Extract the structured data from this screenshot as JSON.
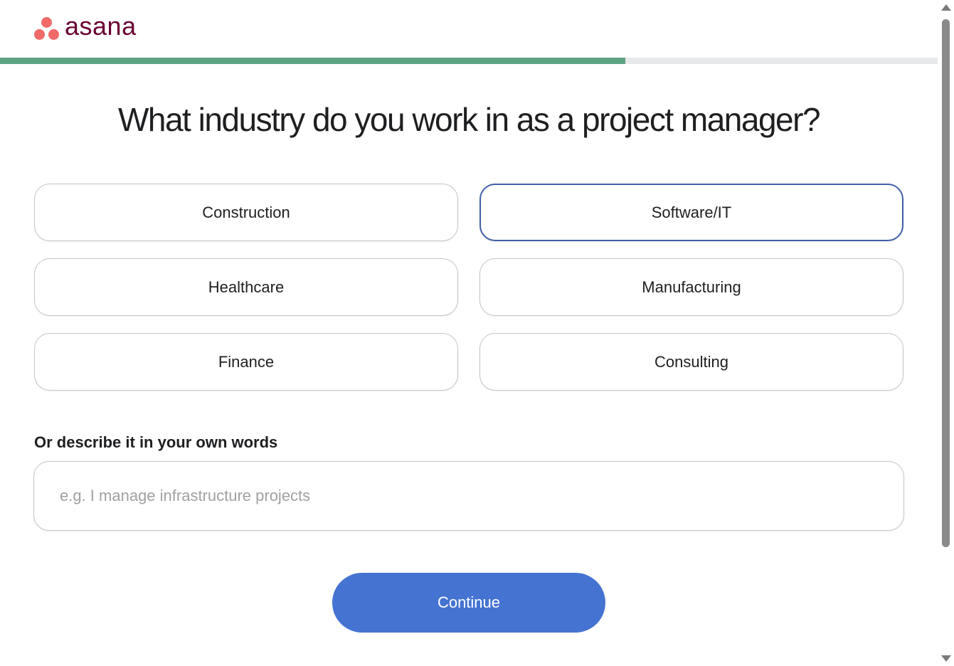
{
  "brand": {
    "name": "asana",
    "logo_color": "#690031",
    "dot_color": "#f06a6a"
  },
  "progress": {
    "fraction": 0.667,
    "fill_color": "#5da283"
  },
  "question": {
    "title": "What industry do you work in as a project manager?"
  },
  "options": [
    {
      "label": "Construction",
      "selected": false
    },
    {
      "label": "Software/IT",
      "selected": true
    },
    {
      "label": "Healthcare",
      "selected": false
    },
    {
      "label": "Manufacturing",
      "selected": false
    },
    {
      "label": "Finance",
      "selected": false
    },
    {
      "label": "Consulting",
      "selected": false
    }
  ],
  "describe": {
    "label": "Or describe it in your own words",
    "value": "",
    "placeholder": "e.g. I manage infrastructure projects"
  },
  "actions": {
    "continue_label": "Continue",
    "accent": "#4573d2"
  }
}
